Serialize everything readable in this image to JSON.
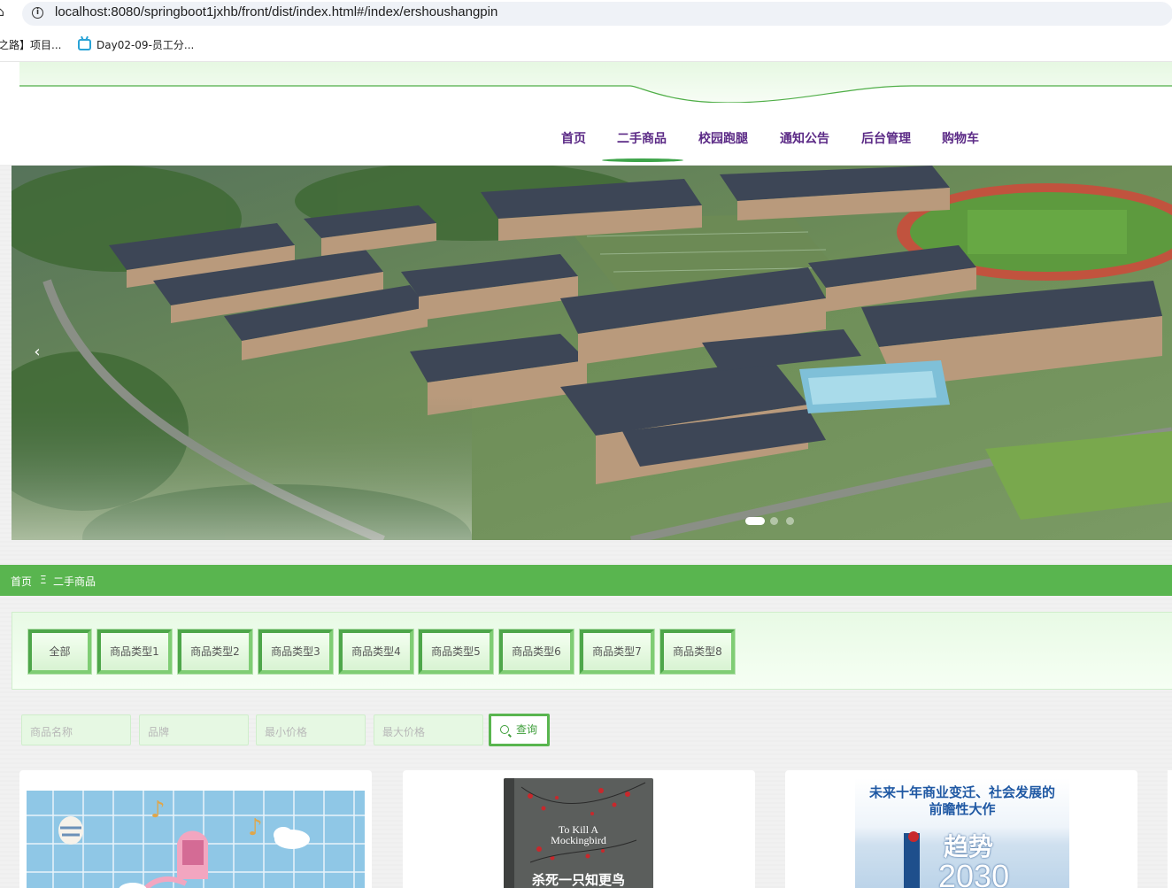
{
  "browser": {
    "url": "localhost:8080/springboot1jxhb/front/dist/index.html#/index/ershoushangpin",
    "bookmarks": [
      {
        "label": "之路】项目..."
      },
      {
        "label": "Day02-09-员工分..."
      }
    ]
  },
  "nav": {
    "items": [
      {
        "label": "首页"
      },
      {
        "label": "二手商品"
      },
      {
        "label": "校园跑腿"
      },
      {
        "label": "通知公告"
      },
      {
        "label": "后台管理"
      },
      {
        "label": "购物车"
      }
    ],
    "active_index": 1
  },
  "carousel": {
    "prev_icon": "chevron-left-icon",
    "slide_count": 3,
    "active_slide": 0
  },
  "breadcrumb": {
    "home": "首页",
    "separator": "Ξ",
    "current": "二手商品"
  },
  "categories": {
    "items": [
      "全部",
      "商品类型1",
      "商品类型2",
      "商品类型3",
      "商品类型4",
      "商品类型5",
      "商品类型6",
      "商品类型7",
      "商品类型8"
    ]
  },
  "search": {
    "name_placeholder": "商品名称",
    "brand_placeholder": "品牌",
    "min_price_placeholder": "最小价格",
    "max_price_placeholder": "最大价格",
    "button_label": "查询",
    "button_icon": "search-icon"
  },
  "products": {
    "book1": {
      "title_en_line1": "To Kill A",
      "title_en_line2": "Mockingbird",
      "title_cn": "杀死一只知更鸟"
    },
    "book2": {
      "tagline_line1": "未来十年商业变迁、社会发展的",
      "tagline_line2": "前瞻性大作",
      "title": "趋势",
      "year": "2030"
    }
  },
  "colors": {
    "primary_green": "#59b54f",
    "nav_text": "#5b2a86",
    "page_bg": "#f1f1f1"
  }
}
